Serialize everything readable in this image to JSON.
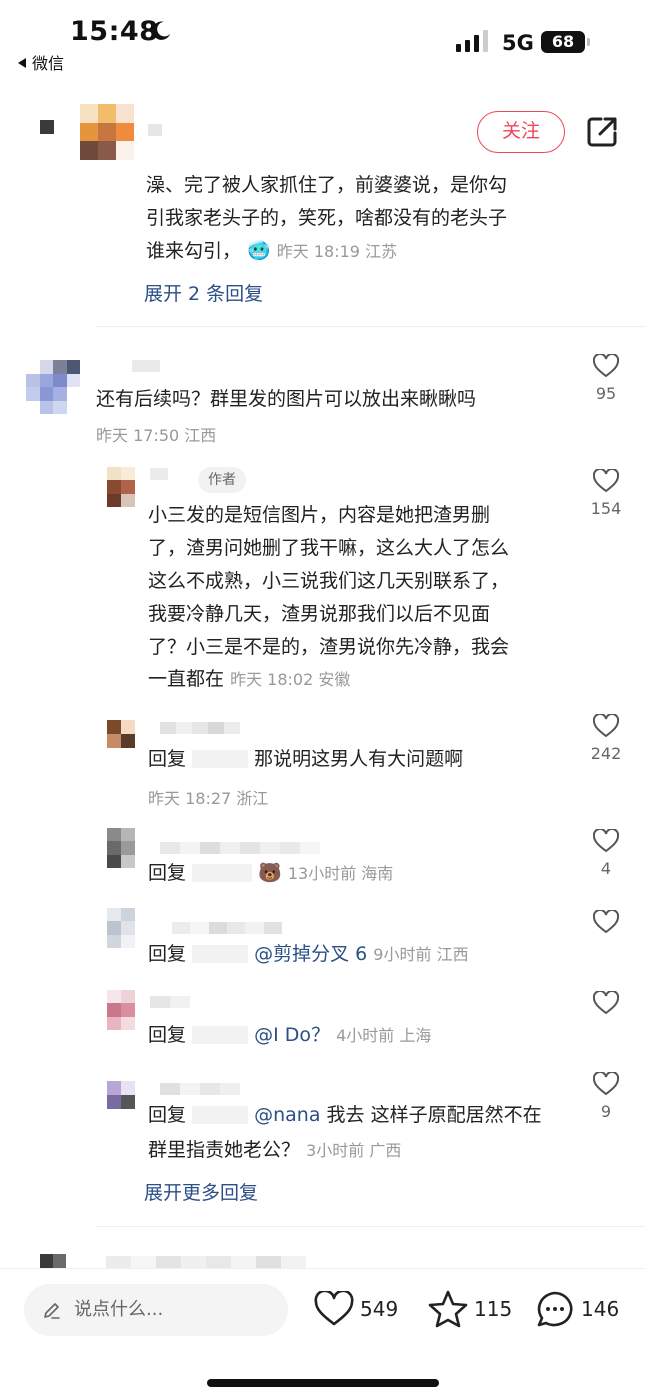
{
  "status_bar": {
    "time": "15:48",
    "back_app": "微信",
    "network": "5G",
    "battery": "68"
  },
  "post": {
    "follow_label": "关注"
  },
  "comments": {
    "c0": {
      "line1": "澡、完了被人家抓住了，前婆婆说，是你勾",
      "line2": "引我家老头子的，笑死，啥都没有的老头子",
      "line3": "谁来勾引，",
      "emoji": "🥶",
      "meta": "昨天 18:19 江苏",
      "expand": "展开 2 条回复"
    },
    "c1": {
      "text": "还有后续吗？群里发的图片可以放出来瞅瞅吗",
      "meta": "昨天 17:50 江西",
      "likes": "95"
    },
    "r1": {
      "tag": "作者",
      "lines": [
        "小三发的是短信图片，内容是她把渣男删",
        "了，渣男问她删了我干嘛，这么大人了怎么",
        "这么不成熟，小三说我们这几天别联系了，",
        "我要冷静几天，渣男说那我们以后不见面",
        "了？小三是不是的，渣男说你先冷静，我会"
      ],
      "last_line": "一直都在",
      "meta": "昨天 18:02 安徽",
      "likes": "154"
    },
    "r2": {
      "prefix": "回复",
      "text": "那说明这男人有大问题啊",
      "meta": "昨天 18:27 浙江",
      "likes": "242"
    },
    "r3": {
      "prefix": "回复",
      "emoji": "🐻",
      "meta": "13小时前 海南",
      "likes": "4"
    },
    "r4": {
      "prefix": "回复",
      "mention": "@剪掉分叉 6",
      "meta": "9小时前 江西"
    },
    "r5": {
      "prefix": "回复",
      "mention": "@I Do？",
      "meta": "4小时前 上海"
    },
    "r6": {
      "prefix": "回复",
      "mention": "@nana",
      "text1": "我去 这样子原配居然不在",
      "line2": "群里指责她老公？",
      "meta": "3小时前 广西",
      "likes": "9"
    },
    "expand_more": "展开更多回复"
  },
  "bottom_bar": {
    "input_placeholder": "说点什么...",
    "likes": "549",
    "stars": "115",
    "comments": "146"
  },
  "icons": {
    "moon": "moon-icon",
    "signal": "signal-icon",
    "share": "share-icon",
    "heart": "heart-icon",
    "star": "star-icon",
    "chat": "chat-icon",
    "pencil": "pencil-icon"
  },
  "colors": {
    "accent": "#f04657",
    "link": "#2b4f86",
    "meta": "#999999"
  }
}
